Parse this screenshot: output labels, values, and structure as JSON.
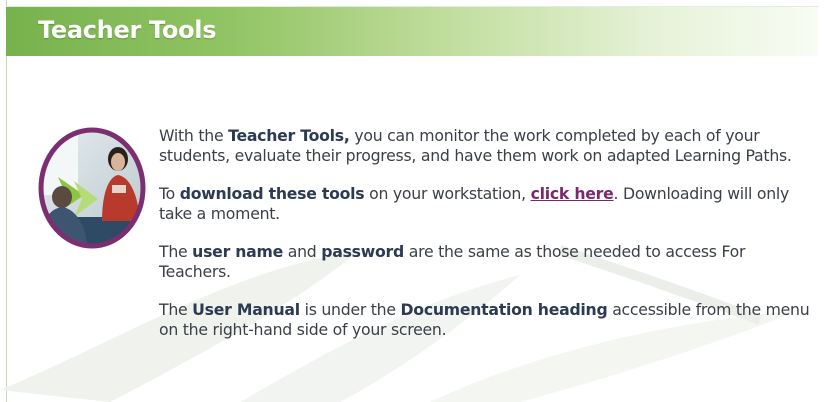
{
  "header": {
    "title": "Teacher Tools"
  },
  "photo": {
    "icon": "teacher-students-photo",
    "ring_color": "#7b2e72"
  },
  "content": {
    "p1": {
      "t1": "With the ",
      "b1": "Teacher Tools,",
      "t2": " you can monitor the work completed by each of your students, evaluate their progress, and have them work on adapted Learning Paths."
    },
    "p2": {
      "t1": "To ",
      "b1": "download these tools",
      "t2": " on your workstation, ",
      "link": "click here",
      "t3": ". Downloading will only take a moment."
    },
    "p3": {
      "t1": "The ",
      "b1": "user name",
      "t2": " and ",
      "b2": "password",
      "t3": " are the same as those needed to access For Teachers."
    },
    "p4": {
      "t1": "The ",
      "b1": "User Manual",
      "t2": " is under the ",
      "b2": "Documentation heading",
      "t3": " accessible from the menu on the right-hand side of your screen."
    }
  },
  "colors": {
    "header_green": "#77b24d",
    "link": "#7a2a6a",
    "text": "#3a3f48",
    "bold_text": "#2c3b52"
  }
}
